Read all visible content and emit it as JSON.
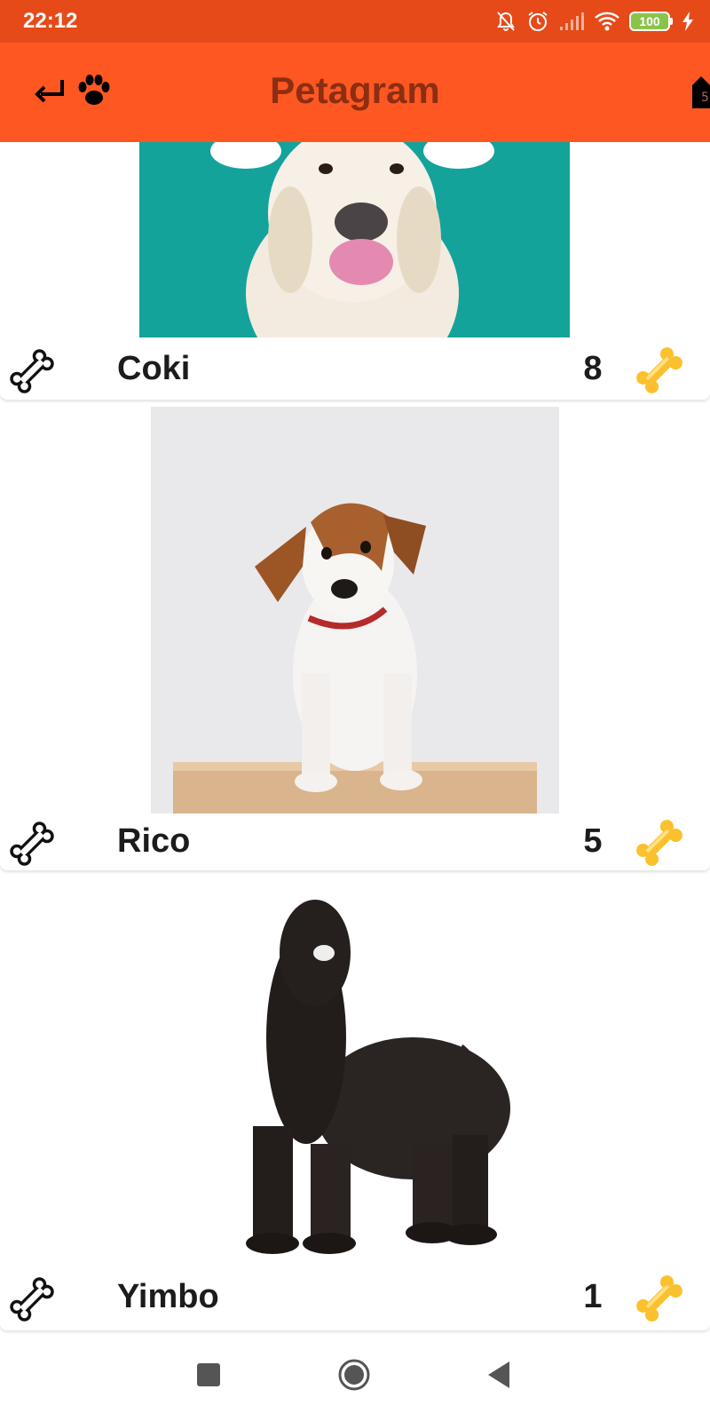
{
  "status_bar": {
    "time": "22:12",
    "battery": "100",
    "icons": [
      "mute-bell-icon",
      "alarm-icon",
      "signal-icon",
      "wifi-icon",
      "battery-icon",
      "charging-icon"
    ],
    "color": "#E64A19"
  },
  "app_bar": {
    "title": "Petagram",
    "color": "#FF5722",
    "title_color": "#8B2E12",
    "icons": [
      "back-arrow-icon",
      "paw-icon",
      "top-five-icon"
    ]
  },
  "pets": [
    {
      "name": "Coki",
      "rating": "8",
      "photo": "golden retriever puppy on teal background"
    },
    {
      "name": "Rico",
      "rating": "5",
      "photo": "jack russell puppy on wooden box"
    },
    {
      "name": "Yimbo",
      "rating": "1",
      "photo": "black afghan hound on white background"
    }
  ],
  "nav_bar": {
    "icons": [
      "recent-apps-icon",
      "home-icon",
      "back-icon"
    ]
  }
}
